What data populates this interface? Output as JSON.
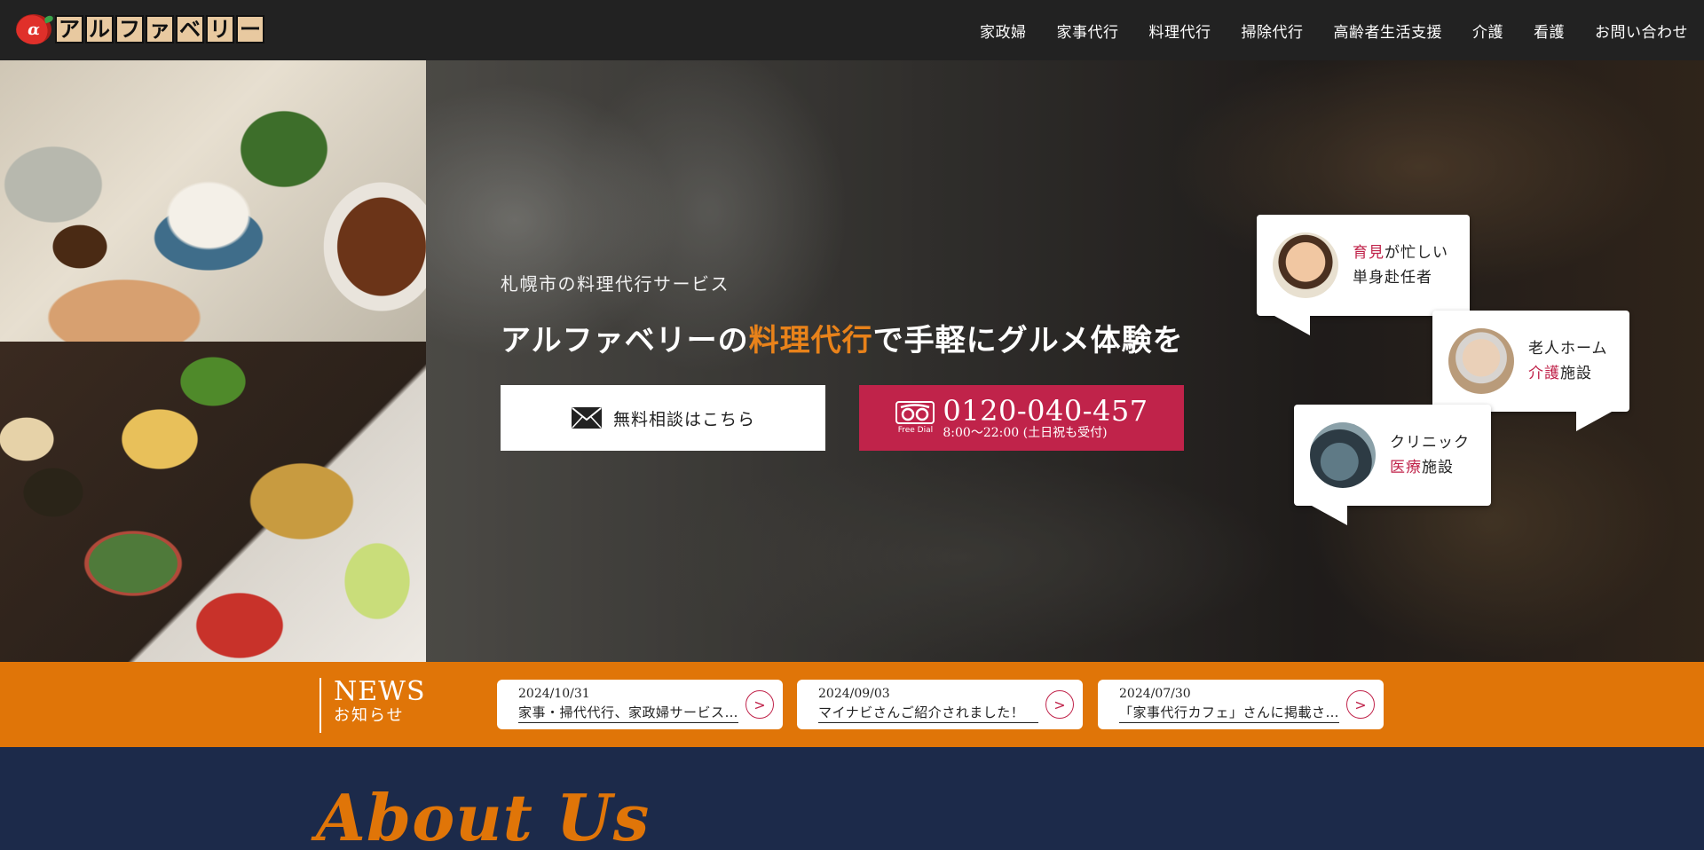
{
  "brand": {
    "logo_chars": [
      "ア",
      "ル",
      "フ",
      "ァ",
      "ベ",
      "リ",
      "ー"
    ],
    "accent_color": "#e07508",
    "red_color": "#c0234a",
    "navy_color": "#1c2a4a"
  },
  "nav": {
    "items": [
      "家政婦",
      "家事代行",
      "料理代行",
      "掃除代行",
      "高齢者生活支援",
      "介護",
      "看護",
      "お問い合わせ"
    ]
  },
  "hero": {
    "subtitle": "札幌市の料理代行サービス",
    "title_before": "アルファベリーの",
    "title_accent": "料理代行",
    "title_after": "で手軽にグルメ体験を",
    "consult_button": "無料相談はこちら",
    "freedial_label": "Free Dial",
    "phone_number": "0120-040-457",
    "phone_hours": "8:00〜22:00 (土日祝も受付)"
  },
  "bubbles": [
    {
      "red": "育見",
      "line1_rest": "が忙しい",
      "line2": "単身赴任者"
    },
    {
      "line1": "老人ホーム",
      "red": "介護",
      "line2_rest": "施設"
    },
    {
      "line1": "クリニック",
      "red": "医療",
      "line2_rest": "施設"
    }
  ],
  "news": {
    "title": "NEWS",
    "subtitle": "お知らせ",
    "items": [
      {
        "date": "2024/10/31",
        "text": "家事・掃代代行、家政婦サービスの…"
      },
      {
        "date": "2024/09/03",
        "text": "マイナビさんご紹介されました！"
      },
      {
        "date": "2024/07/30",
        "text": "「家事代行カフェ」さんに掲載さ…"
      }
    ],
    "arrow": ">"
  },
  "about": {
    "title": "About Us"
  },
  "icons": [
    "mail-icon",
    "freedial-icon",
    "chevron-right-icon"
  ]
}
